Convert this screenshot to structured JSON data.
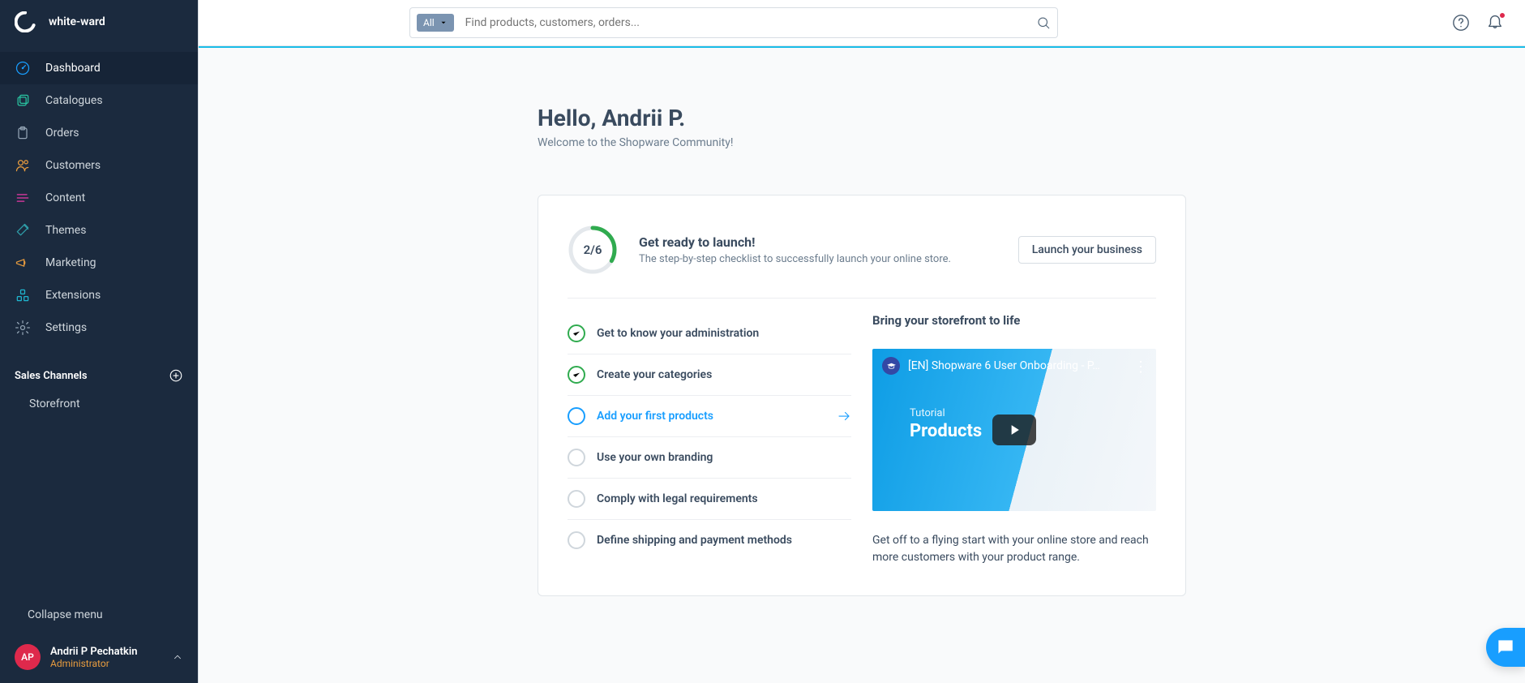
{
  "brand": "white-ward",
  "search": {
    "scope": "All",
    "placeholder": "Find products, customers, orders..."
  },
  "sidebar": {
    "items": [
      {
        "label": "Dashboard",
        "icon": "gauge",
        "color": "#189eff",
        "active": true
      },
      {
        "label": "Catalogues",
        "icon": "catalogues",
        "color": "#29c6a2"
      },
      {
        "label": "Orders",
        "icon": "clipboard",
        "color": "#93a4b5"
      },
      {
        "label": "Customers",
        "icon": "people",
        "color": "#e89c3f"
      },
      {
        "label": "Content",
        "icon": "content",
        "color": "#e839a7"
      },
      {
        "label": "Themes",
        "icon": "themes",
        "color": "#2f9da8"
      },
      {
        "label": "Marketing",
        "icon": "megaphone",
        "color": "#e89c3f"
      },
      {
        "label": "Extensions",
        "icon": "extensions",
        "color": "#1fb6d0"
      },
      {
        "label": "Settings",
        "icon": "gear",
        "color": "#93a4b5"
      }
    ],
    "salesChannelsLabel": "Sales Channels",
    "channels": [
      {
        "label": "Storefront"
      }
    ],
    "collapse": "Collapse menu",
    "user": {
      "initials": "AP",
      "name": "Andrii P Pechatkin",
      "role": "Administrator"
    }
  },
  "page": {
    "greeting": "Hello, Andrii P.",
    "sub": "Welcome to the Shopware Community!"
  },
  "launch": {
    "progress": "2/6",
    "completed": 2,
    "total": 6,
    "title": "Get ready to launch!",
    "sub": "The step-by-step checklist to successfully launch your online store.",
    "button": "Launch your business"
  },
  "checklist": [
    {
      "label": "Get to know your administration",
      "state": "done"
    },
    {
      "label": "Create your categories",
      "state": "done"
    },
    {
      "label": "Add your first products",
      "state": "active"
    },
    {
      "label": "Use your own branding",
      "state": "todo"
    },
    {
      "label": "Comply with legal requirements",
      "state": "todo"
    },
    {
      "label": "Define shipping and payment methods",
      "state": "todo"
    }
  ],
  "promo": {
    "title": "Bring your storefront to life",
    "videoTitle": "[EN] Shopware 6 User Onboarding - P…",
    "videoTextSmall": "Tutorial",
    "videoTextBig": "Products",
    "description": "Get off to a flying start with your online store and reach more customers with your product range."
  }
}
